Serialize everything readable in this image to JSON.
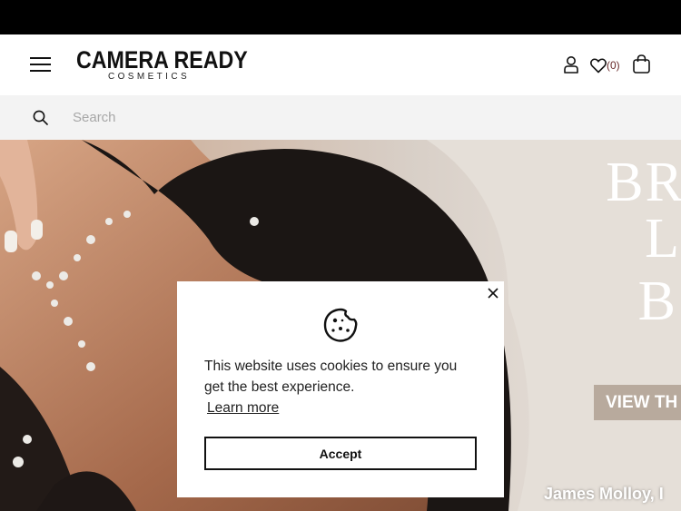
{
  "header": {
    "logo_main": "CAMERA READY",
    "logo_sub": "COSMETICS",
    "wishlist_count": "(0)"
  },
  "search": {
    "placeholder": "Search"
  },
  "hero": {
    "title_lines": [
      "BR",
      "L",
      "B"
    ],
    "cta_label": "VIEW TH",
    "photo_credit": "James Molloy, I"
  },
  "cookie_banner": {
    "message": "This website uses cookies to ensure you get the best experience.",
    "learn_more": "Learn more",
    "accept": "Accept"
  },
  "colors": {
    "topbar": "#000000",
    "searchbar": "#f3f3f3",
    "wishlist_count": "#6a2b2b",
    "hero_button": "#b8aa9d"
  },
  "icons": [
    "menu-icon",
    "user-icon",
    "heart-icon",
    "bag-icon",
    "search-icon",
    "cookie-icon",
    "close-icon"
  ]
}
